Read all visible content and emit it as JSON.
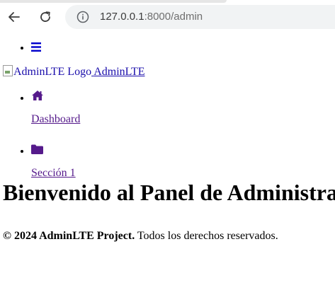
{
  "browser": {
    "url_host": "127.0.0.1",
    "url_rest": ":8000/admin"
  },
  "navbar": {
    "menu_icon": "bars-icon"
  },
  "brand": {
    "logo_alt": "AdminLTE Logo",
    "name": "AdminLTE"
  },
  "sidebar": {
    "items": [
      {
        "icon": "home-icon",
        "label": "Dashboard"
      },
      {
        "icon": "folder-icon",
        "label": "Sección 1"
      }
    ]
  },
  "main": {
    "heading": "Bienvenido al Panel de Administración"
  },
  "footer": {
    "copyright": "© 2024 AdminLTE Project.",
    "rights": " Todos los derechos reservados."
  },
  "colors": {
    "link": "#1a0dab",
    "visited_link": "#551a8b",
    "icon": "#0000cc"
  }
}
